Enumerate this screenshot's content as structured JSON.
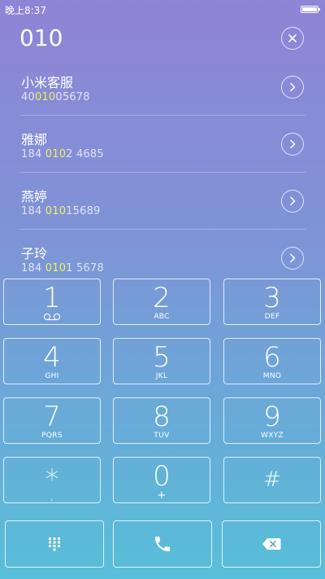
{
  "status_bar": {
    "time": "晚上8:37"
  },
  "dialed_number": "010",
  "results": [
    {
      "name": "小米客服",
      "phone_pre": "40",
      "phone_match": "010",
      "phone_post": "05678"
    },
    {
      "name": "雅娜",
      "phone_pre": "184 ",
      "phone_match": "010",
      "phone_post": "2 4685"
    },
    {
      "name": "燕婷",
      "phone_pre": "184 ",
      "phone_match": "010",
      "phone_post": "15689"
    },
    {
      "name": "子玲",
      "phone_pre": "184 ",
      "phone_match": "010",
      "phone_post": "1 5678"
    }
  ],
  "keypad": [
    {
      "digit": "1",
      "letters": "",
      "icon": "voicemail-icon"
    },
    {
      "digit": "2",
      "letters": "ABC"
    },
    {
      "digit": "3",
      "letters": "DEF"
    },
    {
      "digit": "4",
      "letters": "GHI"
    },
    {
      "digit": "5",
      "letters": "JKL"
    },
    {
      "digit": "6",
      "letters": "MNO"
    },
    {
      "digit": "7",
      "letters": "PQRS"
    },
    {
      "digit": "8",
      "letters": "TUV"
    },
    {
      "digit": "9",
      "letters": "WXYZ"
    },
    {
      "digit": "*",
      "letters": ","
    },
    {
      "digit": "0",
      "letters": "+"
    },
    {
      "digit": "#",
      "letters": ""
    }
  ],
  "actions": [
    {
      "name": "keypad-toggle",
      "icon": "keypad-grid-icon"
    },
    {
      "name": "call",
      "icon": "phone-icon"
    },
    {
      "name": "backspace",
      "icon": "backspace-icon"
    }
  ],
  "colors": {
    "highlight": "#f3f05b",
    "border": "#ffffff"
  }
}
